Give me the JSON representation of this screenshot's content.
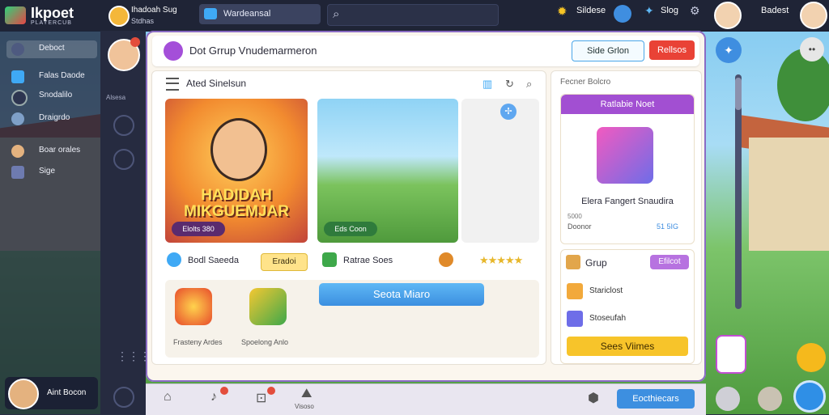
{
  "app": {
    "logo_title": "Ikpoet",
    "logo_sub": "PLAYERCUB"
  },
  "topbar": {
    "user_name": "Ihadoah Sug",
    "user_status": "Stdhas",
    "tab_label": "Wardeansal",
    "search_placeholder": "",
    "item1": "Sildese",
    "item2": "Slog",
    "right_label": "Badest"
  },
  "sidebar": {
    "items": [
      {
        "label": "Deboct",
        "icon": "avatar-icon",
        "active": true
      },
      {
        "label": "Falas Daode",
        "icon": "folder-icon",
        "active": false
      },
      {
        "label": "Snodalilo",
        "icon": "circle-icon",
        "active": false
      },
      {
        "label": "Draigrdo",
        "icon": "globe-icon",
        "active": false
      },
      {
        "label": "Boar orales",
        "icon": "person-icon",
        "active": false
      },
      {
        "label": "Sige",
        "icon": "chart-icon",
        "active": false
      }
    ],
    "footer_label": "Aint Bocon"
  },
  "rail": {
    "label": "Alsesa"
  },
  "main": {
    "title": "Dot Grrup Vnudemarmeron",
    "btn_outline": "Side Grlon",
    "btn_red": "Rellsos",
    "panel_title": "Ated Sinelsun",
    "card1_title": "HADIDAH MIKGUEMJAR",
    "card1_pill": "Elolts 380",
    "card2_pill": "Eds Coon",
    "row_label1": "Bodl Saeeda",
    "chip_label": "Eradoi",
    "row_label2": "Ratrae Soes",
    "big_button": "Seota Miaro",
    "sub_label1": "Frasteny Ardes",
    "sub_label2": "Spoelong Anlo"
  },
  "right": {
    "title": "Fecner Bolcro",
    "offer_header": "Ratlabie Noet",
    "offer_title": "Elera Fangert Snaudira",
    "offer_meta": "5000",
    "offer_price": "Doonor",
    "offer_rating": "51 5IG",
    "group_label": "Grup",
    "group_button": "Efilcot",
    "group_items": [
      "Stariclost",
      "Stoseufah"
    ],
    "yellow_button": "Sees Viimes"
  },
  "bottom": {
    "label": "Visoso",
    "button": "Eocthiecars"
  }
}
